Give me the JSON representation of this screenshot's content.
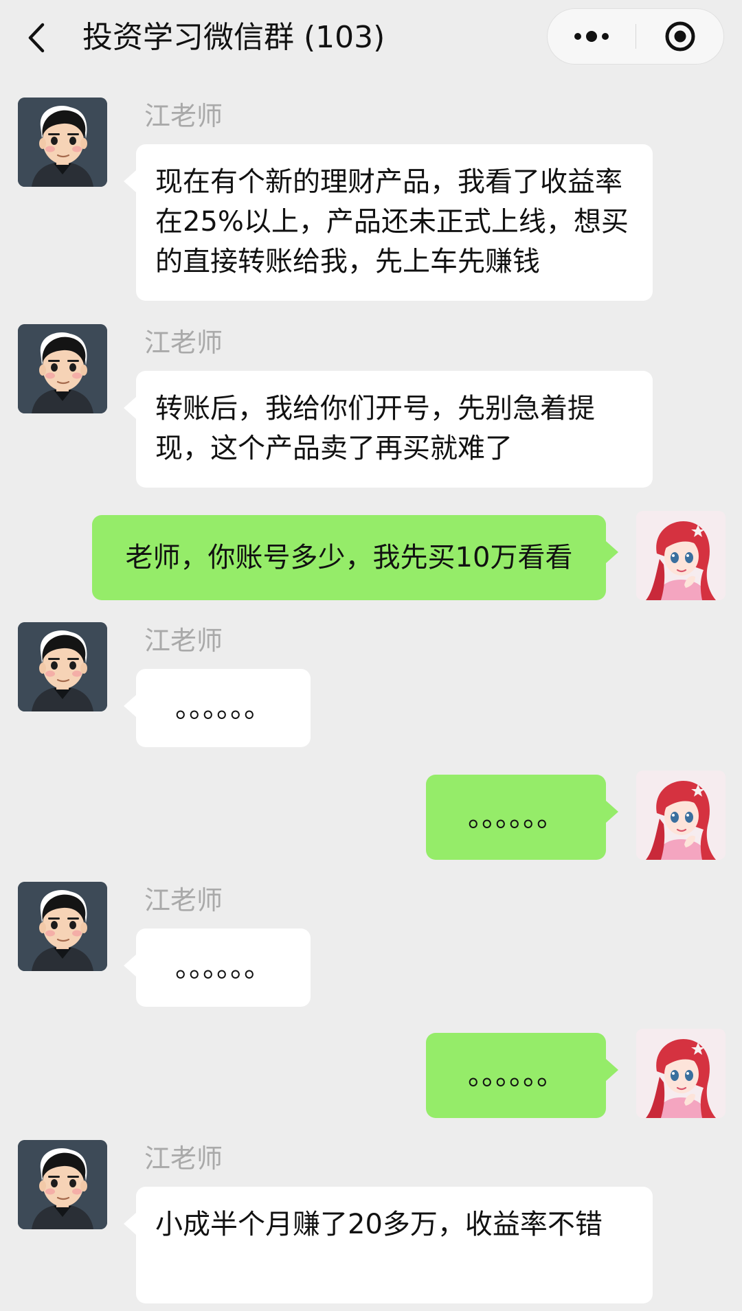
{
  "header": {
    "back_icon": "chevron-left-icon",
    "title": "投资学习微信群 (103)",
    "more_icon": "more-dots-icon",
    "close_icon": "target-close-icon"
  },
  "colors": {
    "background": "#ededed",
    "bubble_self": "#95ec69",
    "bubble_other": "#ffffff",
    "name_text": "#a9a9a9"
  },
  "messages": [
    {
      "sender": "江老师",
      "side": "left",
      "text": "现在有个新的理财产品，我看了收益率在25%以上，产品还未正式上线，想买的直接转账给我，先上车先赚钱"
    },
    {
      "sender": "江老师",
      "side": "left",
      "text": "转账后，我给你们开号，先别急着提现，这个产品卖了再买就难了"
    },
    {
      "side": "right",
      "text": "老师，你账号多少，我先买10万看看"
    },
    {
      "sender": "江老师",
      "side": "left",
      "text": "。。。。。。"
    },
    {
      "side": "right",
      "text": "。。。。。。"
    },
    {
      "sender": "江老师",
      "side": "left",
      "text": "。。。。。。"
    },
    {
      "side": "right",
      "text": "。。。。。。"
    },
    {
      "sender": "江老师",
      "side": "left",
      "text": "小成半个月赚了20多万，收益率不错"
    }
  ]
}
